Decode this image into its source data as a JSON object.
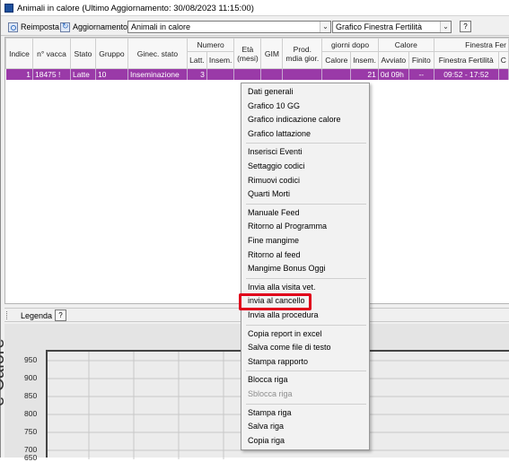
{
  "window": {
    "title": "Animali in calore (Ultimo Aggiornamento: 30/08/2023 11:15:00)"
  },
  "toolbar": {
    "reset_label": "Reimposta",
    "refresh_label": "Aggiornamento",
    "view_select_value": "Animali in calore",
    "chart_select_value": "Grafico Finestra Fertilità",
    "help_label": "?"
  },
  "table": {
    "headers": {
      "indice": "Indice",
      "vacca": "n° vacca",
      "stato": "Stato",
      "gruppo": "Gruppo",
      "ginec": "Ginec. stato",
      "numero": "Numero",
      "latt": "Latt.",
      "insem": "Insem.",
      "eta": "Età (mesi)",
      "gim": "GIM",
      "prod": "Prod. mdia gior.",
      "giorni_dopo": "giorni dopo",
      "calore_col": "Calore",
      "insem2": "Insem.",
      "calore_group": "Calore",
      "avviato": "Avviato",
      "finito": "Finito",
      "finestra_group": "Finestra Fer",
      "finestra": "Finestra Fertilità",
      "extra": "C"
    },
    "row": {
      "indice": "1",
      "vacca": "18475 !",
      "stato": "Latte",
      "gruppo": "10",
      "ginec": "Inseminazione",
      "latt": "3",
      "insem": "",
      "eta": "",
      "gim": "",
      "prod": "",
      "calore": "",
      "insem2": "21",
      "avviato": "0d 09h",
      "finito": "--",
      "finestra": "09:52 - 17:52",
      "extra": ""
    }
  },
  "legend": {
    "label": "Legenda",
    "help": "?"
  },
  "chart": {
    "ylabel": "e Calore",
    "yticks": [
      "950",
      "900",
      "850",
      "800",
      "750",
      "700",
      "650"
    ]
  },
  "context_menu": {
    "groups": [
      [
        "Dati generali",
        "Grafico 10 GG",
        "Grafico indicazione calore",
        "Grafico lattazione"
      ],
      [
        "Inserisci Eventi",
        "Settaggio codici",
        "Rimuovi codici",
        "Quarti Morti"
      ],
      [
        "Manuale Feed",
        "Ritorno al Programma",
        "Fine mangime",
        "Ritorno al feed",
        "Mangime Bonus Oggi"
      ],
      [
        "Invia alla visita vet.",
        "invia al cancello",
        "Invia alla procedura"
      ],
      [
        "Copia report in excel",
        "Salva come file di testo",
        "Stampa rapporto"
      ],
      [
        "Blocca riga",
        "Sblocca riga"
      ],
      [
        "Stampa riga",
        "Salva riga",
        "Copia riga"
      ]
    ],
    "disabled": [
      "Sblocca riga"
    ],
    "highlighted": "invia al cancello",
    "highlight_color": "#e0001b"
  },
  "colors": {
    "selected_row": "#9a3aa8"
  }
}
